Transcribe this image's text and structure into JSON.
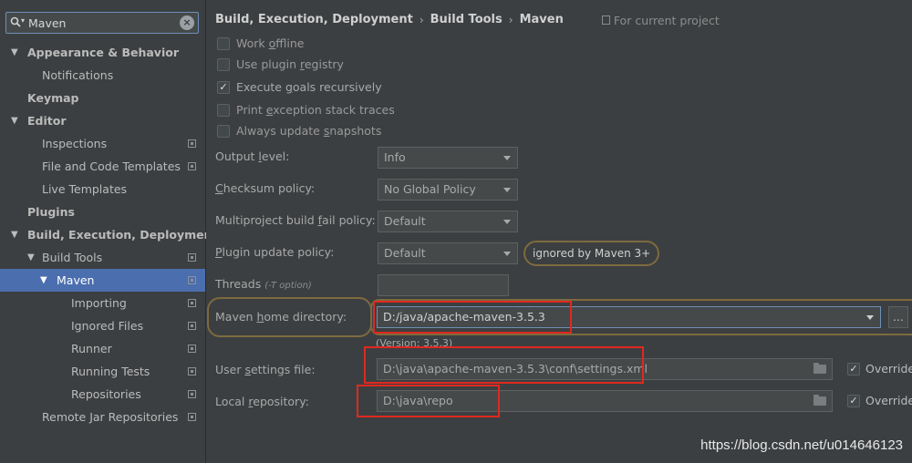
{
  "search": {
    "value": "Maven",
    "clear_label": "×"
  },
  "tree": [
    {
      "arrow": "▼",
      "label": "Appearance & Behavior"
    },
    {
      "label": "Notifications"
    },
    {
      "label": "Keymap"
    },
    {
      "arrow": "▼",
      "label": "Editor"
    },
    {
      "label": "Inspections"
    },
    {
      "label": "File and Code Templates"
    },
    {
      "label": "Live Templates"
    },
    {
      "label": "Plugins"
    },
    {
      "arrow": "▼",
      "label": "Build, Execution, Deployment"
    },
    {
      "arrow": "▼",
      "label": "Build Tools"
    },
    {
      "arrow": "▼",
      "label": "Maven"
    },
    {
      "label": "Importing"
    },
    {
      "label": "Ignored Files"
    },
    {
      "label": "Runner"
    },
    {
      "label": "Running Tests"
    },
    {
      "label": "Repositories"
    },
    {
      "label": "Remote Jar Repositories"
    }
  ],
  "breadcrumb": {
    "items": [
      "Build, Execution, Deployment",
      "Build Tools",
      "Maven"
    ],
    "separator": "›",
    "scope": "For current project"
  },
  "options": {
    "work_offline": {
      "pre": "Work ",
      "mnemonic": "o",
      "post": "ffline",
      "checked": false
    },
    "plugin_registry": {
      "pre": "Use plugin ",
      "mnemonic": "r",
      "post": "egistry",
      "checked": false
    },
    "execute_goals": {
      "pre": "Execute ",
      "mnemonic": "g",
      "post": "oals recursively",
      "checked": true
    },
    "print_exception": {
      "pre": "Print ",
      "mnemonic": "e",
      "post": "xception stack traces",
      "checked": false
    },
    "update_snapshots": {
      "pre": "Always update ",
      "mnemonic": "s",
      "post": "napshots",
      "checked": false
    },
    "checkmark": "✓"
  },
  "fields": {
    "output_level": {
      "pre": "Output ",
      "mnemonic": "l",
      "post": "evel:",
      "value": "Info"
    },
    "checksum_policy": {
      "pre": "",
      "mnemonic": "C",
      "post": "hecksum policy:",
      "value": "No Global Policy"
    },
    "fail_policy": {
      "pre": "Multiproject build ",
      "mnemonic": "f",
      "post": "ail policy:",
      "value": "Default"
    },
    "plugin_update": {
      "pre": "",
      "mnemonic": "P",
      "post": "lugin update policy:",
      "value": "Default",
      "note": "ignored by Maven 3+"
    },
    "threads": {
      "label": "Threads",
      "hint": "(-T option)",
      "value": ""
    },
    "maven_home": {
      "pre": "Maven ",
      "mnemonic": "h",
      "post": "ome directory:",
      "value": "D:/java/apache-maven-3.5.3",
      "version": "(Version: 3.5.3)",
      "browse": "..."
    },
    "user_settings": {
      "pre": "User ",
      "mnemonic": "s",
      "post": "ettings file:",
      "value": "D:\\java\\apache-maven-3.5.3\\conf\\settings.xml"
    },
    "local_repo": {
      "pre": "Local ",
      "mnemonic": "r",
      "post": "epository:",
      "value": "D:\\java\\repo"
    },
    "override_label": "Override"
  },
  "watermark": "https://blog.csdn.net/u014646123",
  "colors": {
    "selection": "#4b6eaf",
    "highlight_outline": "#7d6a3e",
    "annotation_box": "#e0281f"
  }
}
